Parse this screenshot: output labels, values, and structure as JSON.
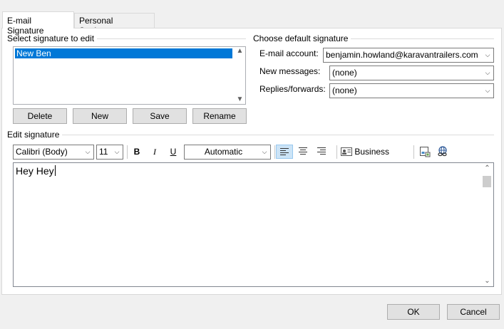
{
  "tabs": [
    {
      "label": "E-mail Signature",
      "active": true
    },
    {
      "label": "Personal Stationery",
      "active": false
    }
  ],
  "select_signature": {
    "label": "Select signature to edit",
    "items": [
      "New Ben"
    ],
    "selected": "New Ben"
  },
  "signature_buttons": {
    "delete": "Delete",
    "new": "New",
    "save": "Save",
    "rename": "Rename"
  },
  "default_signature": {
    "label": "Choose default signature",
    "email_account_label": "E-mail account:",
    "email_account_value": "benjamin.howland@karavantrailers.com",
    "new_messages_label": "New messages:",
    "new_messages_value": "(none)",
    "replies_label": "Replies/forwards:",
    "replies_value": "(none)"
  },
  "edit_signature": {
    "label": "Edit signature",
    "font": "Calibri (Body)",
    "size": "11",
    "bold": "B",
    "italic": "I",
    "underline": "U",
    "color": "Automatic",
    "business_card": "Business Card",
    "content": "Hey Hey"
  },
  "footer": {
    "ok": "OK",
    "cancel": "Cancel"
  },
  "colors": {
    "selection": "#0078d7",
    "active_tool": "#cce4f7"
  }
}
